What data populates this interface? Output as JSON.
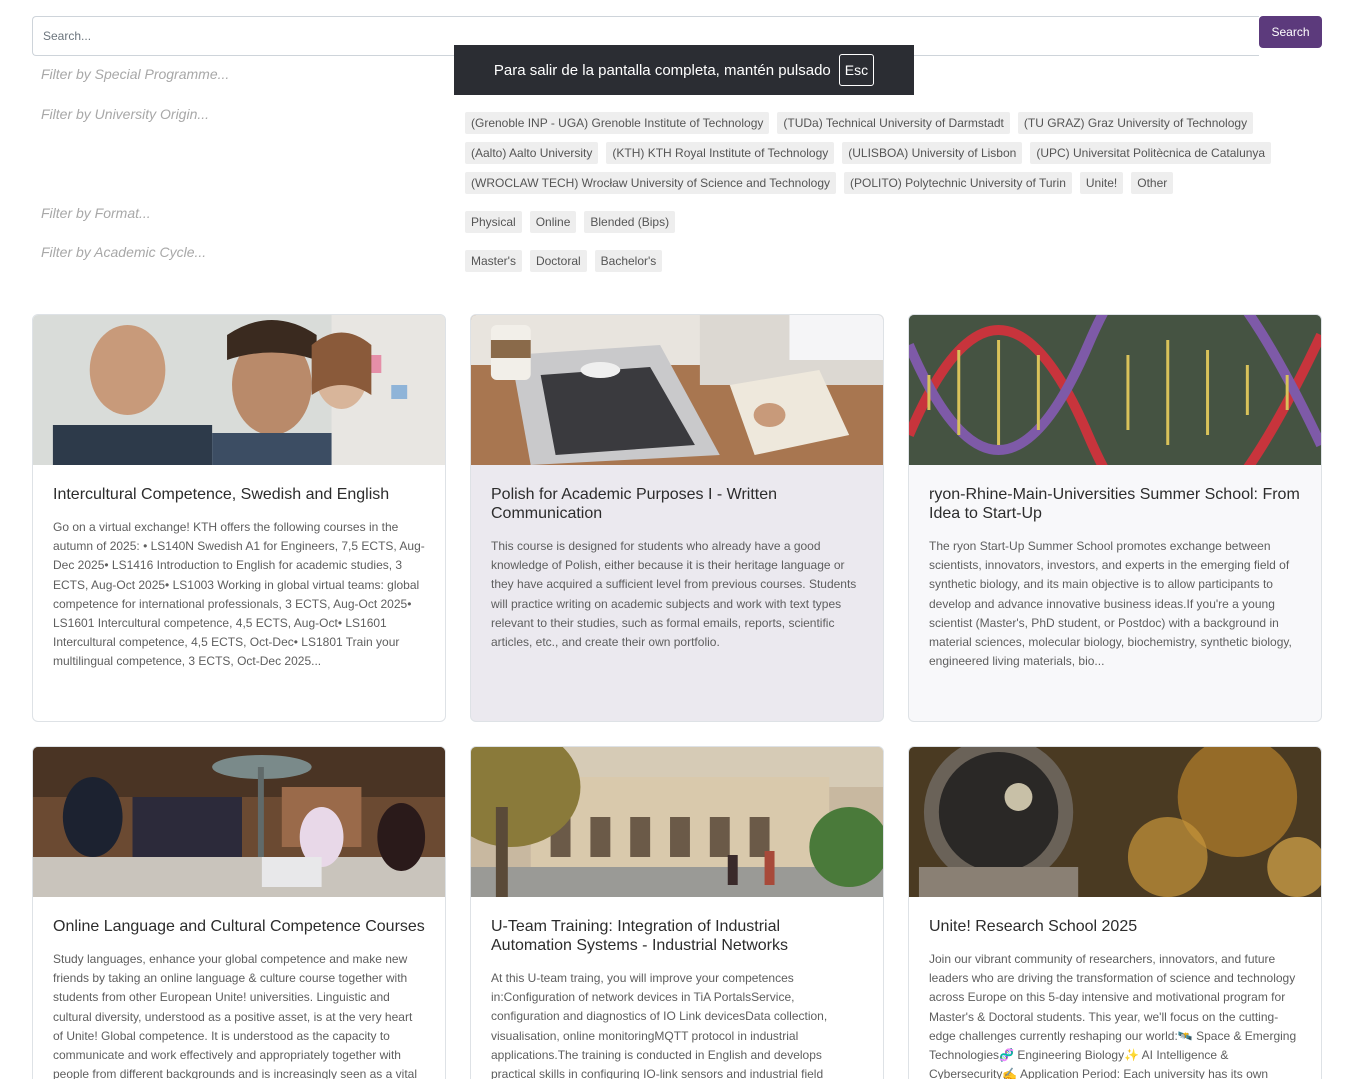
{
  "search": {
    "placeholder": "Search...",
    "button_label": "Search"
  },
  "fullscreen_toast": {
    "message": "Para salir de la pantalla completa, mantén pulsado",
    "key": "Esc"
  },
  "filters": {
    "special_programme": {
      "label": "Filter by Special Programme..."
    },
    "university_origin": {
      "label": "Filter by University Origin...",
      "options": [
        "(Grenoble INP - UGA) Grenoble Institute of Technology",
        "(TUDa) Technical University of Darmstadt",
        "(TU GRAZ) Graz University of Technology",
        "(Aalto) Aalto University",
        "(KTH) KTH Royal Institute of Technology",
        "(ULISBOA) University of Lisbon",
        "(UPC) Universitat Politècnica de Catalunya",
        "(WROCLAW TECH) Wrocław University of Science and Technology",
        "(POLITO) Polytechnic University of Turin",
        "Unite!",
        "Other"
      ]
    },
    "format": {
      "label": "Filter by Format...",
      "options": [
        "Physical",
        "Online",
        "Blended (Bips)"
      ]
    },
    "academic_cycle": {
      "label": "Filter by Academic Cycle...",
      "options": [
        "Master's",
        "Doctoral",
        "Bachelor's"
      ]
    }
  },
  "cards": [
    {
      "title": "Intercultural Competence, Swedish and English",
      "text": "Go on a virtual exchange! KTH offers the following courses in the autumn of 2025: • LS140N Swedish A1 for Engineers, 7,5 ECTS, Aug-Dec 2025• LS1416 Introduction to English for academic studies, 3 ECTS, Aug-Oct 2025• LS1003 Working in global virtual teams: global competence for international professionals, 3 ECTS, Aug-Oct 2025• LS1601 Intercultural competence, 4,5 ECTS, Aug-Oct• LS1601 Intercultural competence, 4,5 ECTS, Oct-Dec• LS1801 Train your multilingual competence, 3 ECTS, Oct-Dec 2025..."
    },
    {
      "title": "Polish for Academic Purposes I - Written Communication",
      "text": "This course is designed for students who already have a good knowledge of Polish, either because it is their heritage language or they have acquired a sufficient level from previous courses. Students will practice writing on academic subjects and work with text types relevant to their studies, such as formal emails, reports, scientific articles, etc., and create their own portfolio."
    },
    {
      "title": "ryon-Rhine-Main-Universities Summer School: From Idea to Start-Up",
      "text": "The ryon Start-Up Summer School promotes exchange between scientists, innovators, investors, and experts in the emerging field of synthetic biology, and its main objective is to allow participants to develop and advance innovative business ideas.If you're a young scientist (Master's, PhD student, or Postdoc) with a background in material sciences, molecular biology, biochemistry, synthetic biology, engineered living materials, bio..."
    },
    {
      "title": "Online Language and Cultural Competence Courses",
      "text": "Study languages, enhance your global competence and make new friends by taking an online language & culture course together with students from other European Unite! universities. Linguistic and cultural diversity, understood as a positive asset, is at the very heart of Unite! Global competence. It is understood as the capacity to communicate and work effectively and appropriately together with people from different backgrounds and is increasingly seen as a vital core"
    },
    {
      "title": "U-Team Training: Integration of Industrial Automation Systems - Industrial Networks",
      "text": "At this U-team traing, you will improve your competences in:Configuration of network devices in TiA PortalsService, configuration and diagnostics of IO Link devicesData collection, visualisation, online monitoringMQTT protocol in industrial applications.The training is conducted in English and develops practical skills in configuring IO-link sensors and industrial field devices. English language skills are"
    },
    {
      "title": "Unite! Research School 2025",
      "text": "Join our vibrant community of researchers, innovators, and future leaders who are driving the transformation of science and technology across Europe on this 5-day intensive and motivational program for Master's & Doctoral students. This year, we'll focus on the cutting-edge challenges currently reshaping our world:🛰️ Space & Emerging Technologies🧬 Engineering Biology✨ AI Intelligence & Cybersecurity✍️ Application Period: Each university has its own"
    }
  ]
}
